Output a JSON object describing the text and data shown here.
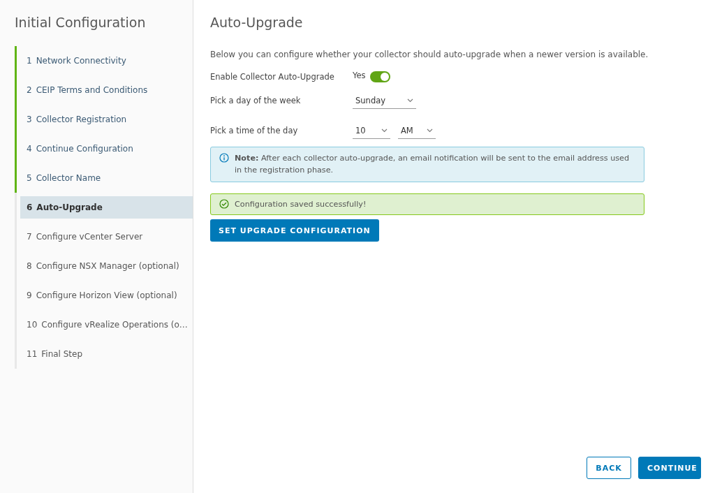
{
  "sidebar": {
    "title": "Initial Configuration",
    "steps": [
      {
        "number": "1",
        "label": "Network Connectivity",
        "completed": true,
        "selected": false
      },
      {
        "number": "2",
        "label": "CEIP Terms and Conditions",
        "completed": true,
        "selected": false
      },
      {
        "number": "3",
        "label": "Collector Registration",
        "completed": true,
        "selected": false
      },
      {
        "number": "4",
        "label": "Continue Configuration",
        "completed": true,
        "selected": false
      },
      {
        "number": "5",
        "label": "Collector Name",
        "completed": true,
        "selected": false
      },
      {
        "number": "6",
        "label": "Auto-Upgrade",
        "completed": false,
        "selected": true
      },
      {
        "number": "7",
        "label": "Configure vCenter Server",
        "completed": false,
        "selected": false
      },
      {
        "number": "8",
        "label": "Configure NSX Manager (optional)",
        "completed": false,
        "selected": false
      },
      {
        "number": "9",
        "label": "Configure Horizon View (optional)",
        "completed": false,
        "selected": false
      },
      {
        "number": "10",
        "label": "Configure vRealize Operations (o…",
        "completed": false,
        "selected": false
      },
      {
        "number": "11",
        "label": "Final Step",
        "completed": false,
        "selected": false
      }
    ]
  },
  "main": {
    "title": "Auto-Upgrade",
    "description": "Below you can configure whether your collector should auto-upgrade when a newer version is available.",
    "fields": [
      {
        "kind": "toggle",
        "label": "Enable Collector Auto-Upgrade",
        "value": "Yes",
        "on": true
      },
      {
        "kind": "select",
        "label": "Pick a day of the week",
        "values": [
          "Sunday"
        ]
      },
      {
        "kind": "select",
        "label": "Pick a time of the day",
        "values": [
          "10",
          "AM"
        ]
      }
    ],
    "alerts": [
      {
        "kind": "info",
        "text": "**Note:** After each collector auto-upgrade, an email notification will be sent to the email address used in the registration phase."
      },
      {
        "kind": "success",
        "text": "Configuration saved successfully!"
      }
    ],
    "action_button": "SET UPGRADE CONFIGURATION"
  },
  "footer": {
    "buttons": [
      {
        "label": "BACK",
        "kind": "outline"
      },
      {
        "label": "CONTINUE",
        "kind": "primary"
      }
    ]
  }
}
